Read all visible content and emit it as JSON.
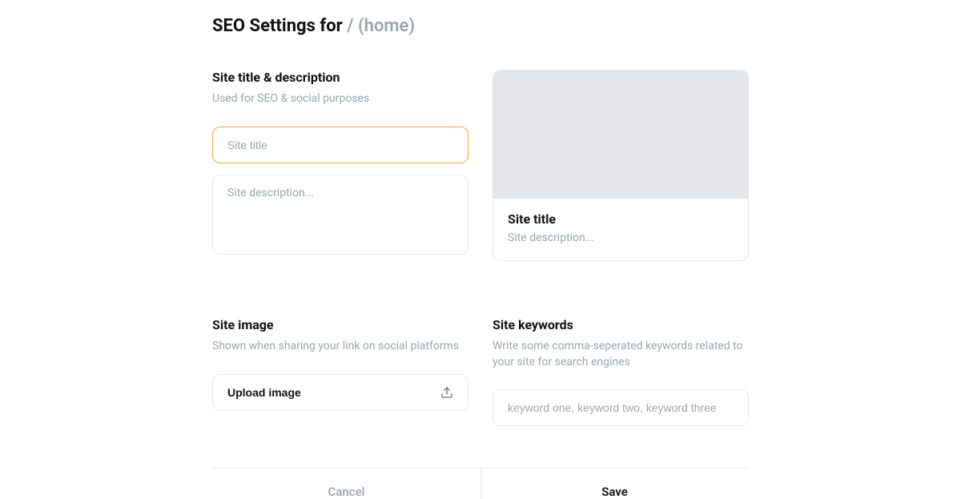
{
  "header": {
    "title_prefix": "SEO Settings for ",
    "path": "/ (home)"
  },
  "left_top": {
    "heading": "Site title & description",
    "sub": "Used for SEO & social purposes",
    "title_field": {
      "value": "",
      "placeholder": "Site title"
    },
    "desc_field": {
      "value": "",
      "placeholder": "Site description..."
    }
  },
  "preview": {
    "title": "Site title",
    "desc": "Site description..."
  },
  "site_image": {
    "heading": "Site image",
    "sub": "Shown when sharing your link on social platforms",
    "button_label": "Upload image"
  },
  "site_keywords": {
    "heading": "Site keywords",
    "sub": "Write some comma-seperated keywords related to your site for search engines",
    "field": {
      "value": "",
      "placeholder": "keyword one, keyword two, keyword three"
    }
  },
  "footer": {
    "cancel": "Cancel",
    "save": "Save"
  }
}
